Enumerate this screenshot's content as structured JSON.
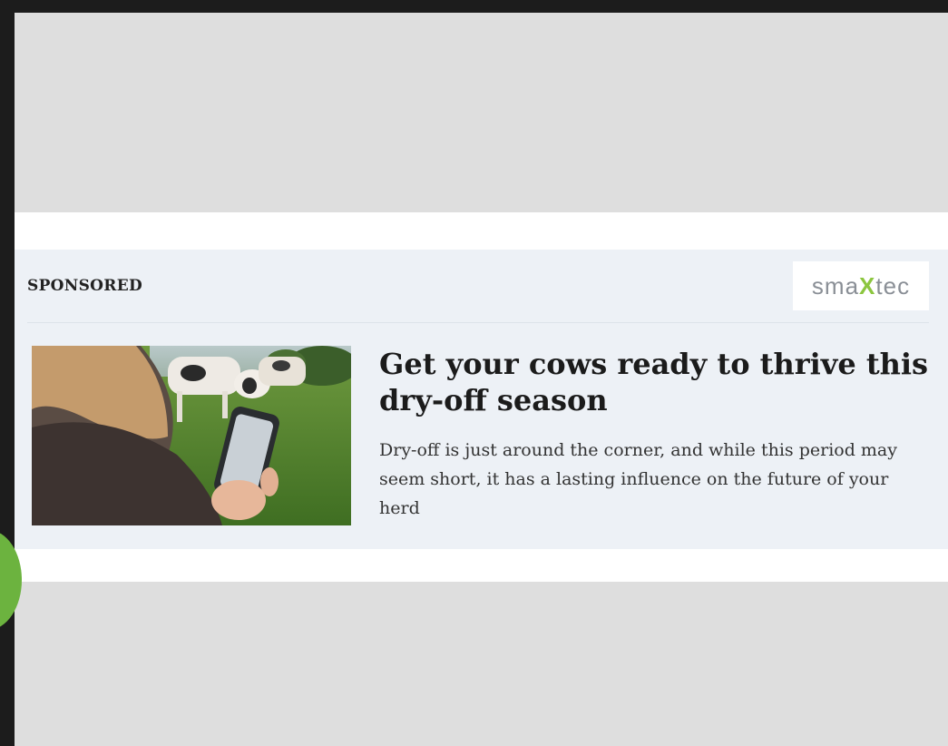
{
  "ad": {
    "label": "SPONSORED",
    "brand": {
      "prefix": "sma",
      "mark": "X",
      "suffix": "tec"
    },
    "headline": "Get your cows ready to thrive this dry-off season",
    "summary": "Dry-off is just around the corner, and while this period may seem short, it has a lasting influence on the future of your herd"
  },
  "colors": {
    "card_bg": "#edf1f6",
    "ad_placeholder": "#dedede",
    "brand_accent": "#8cc63f",
    "floating_button": "#6cb33f"
  }
}
